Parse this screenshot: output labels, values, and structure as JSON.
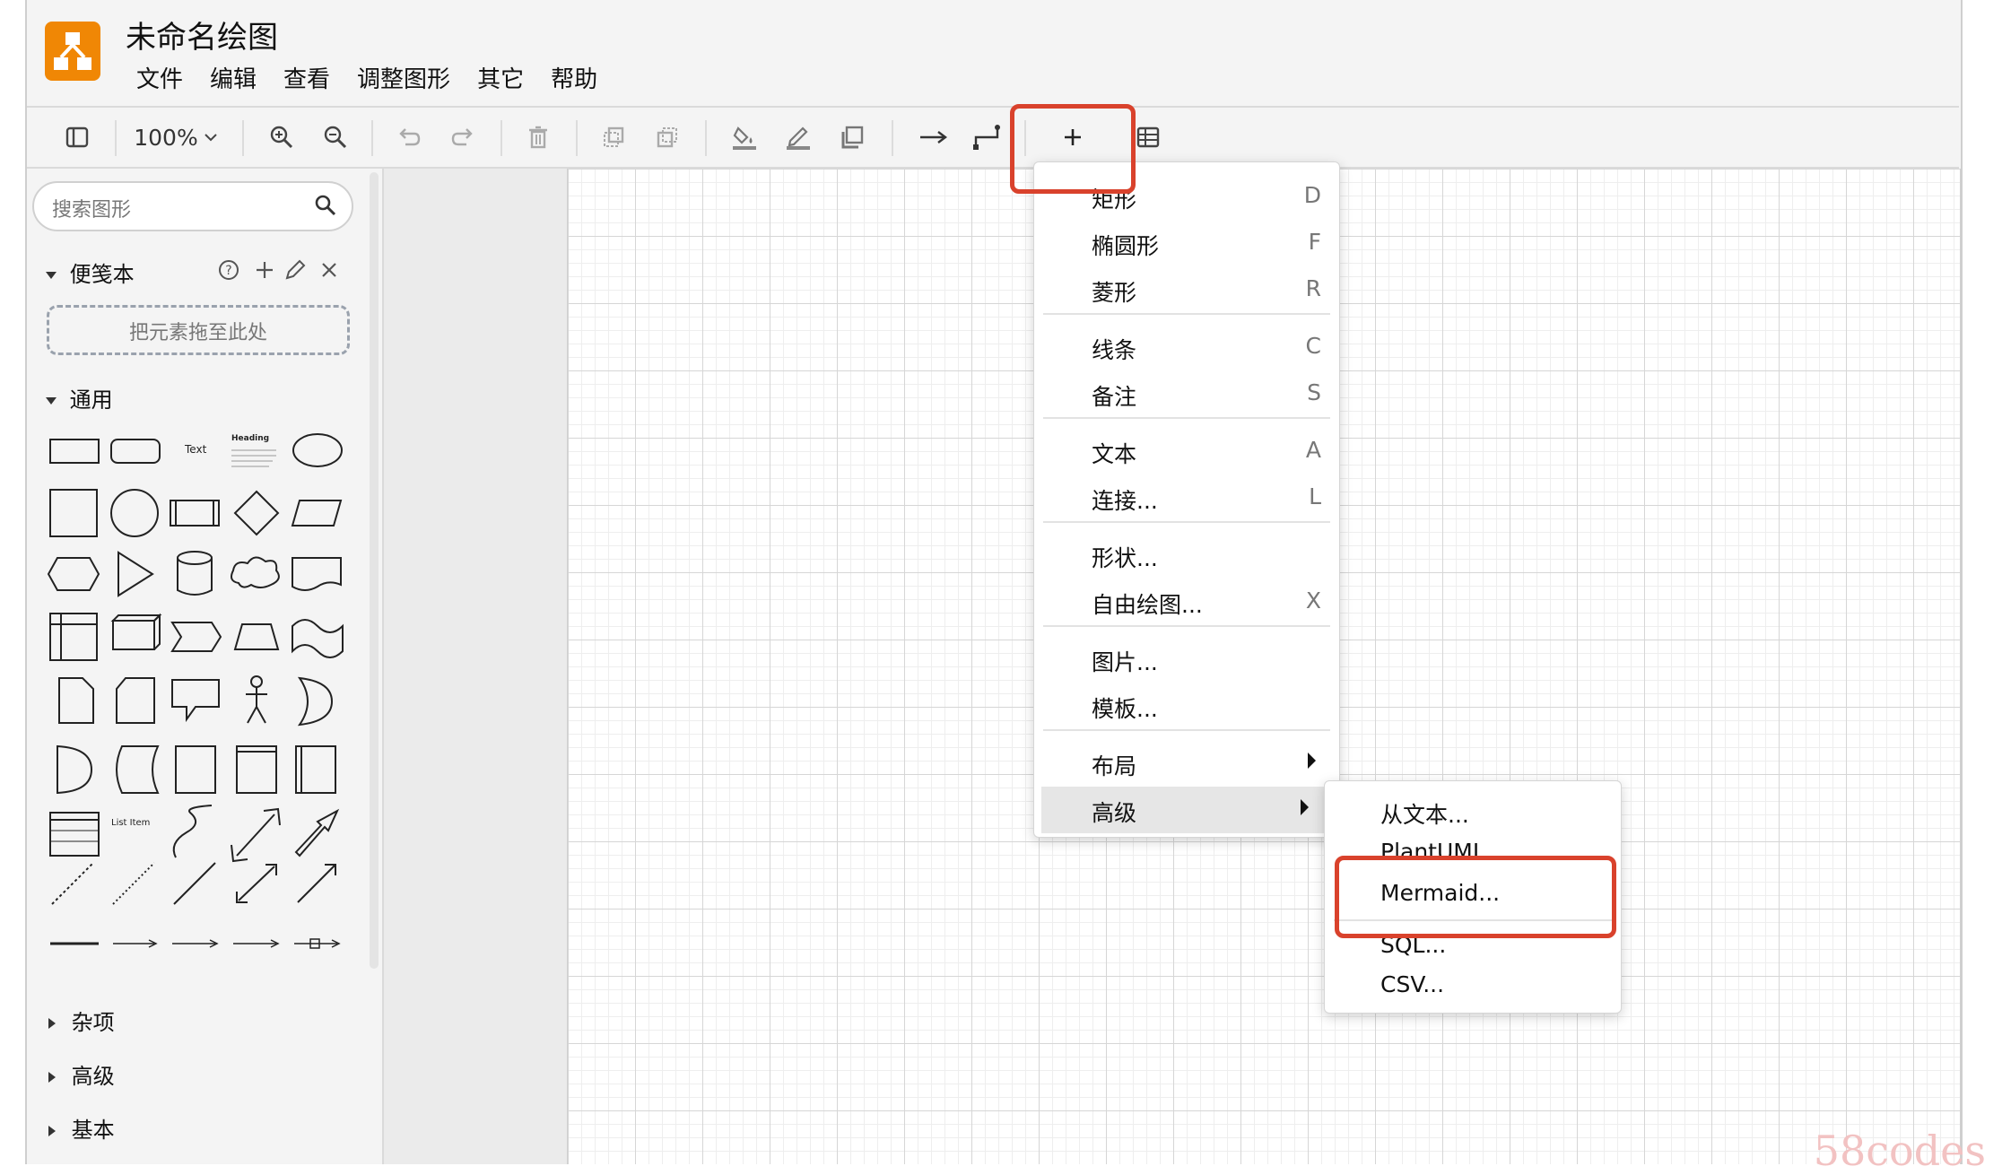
{
  "app": {
    "title": "未命名绘图",
    "menus": [
      "文件",
      "编辑",
      "查看",
      "调整图形",
      "其它",
      "帮助"
    ]
  },
  "toolbar": {
    "zoom_label": "100%"
  },
  "sidebar": {
    "search_placeholder": "搜索图形",
    "scratchpad_title": "便笺本",
    "dropzone_text": "把元素拖至此处",
    "general_title": "通用",
    "shape_text_label": "Text",
    "shape_heading_label": "Heading",
    "shape_list_item_label": "List Item",
    "collapsed_sections": [
      "杂项",
      "高级",
      "基本"
    ]
  },
  "insert_menu": {
    "items": [
      {
        "label": "矩形",
        "key": "D"
      },
      {
        "label": "椭圆形",
        "key": "F"
      },
      {
        "label": "菱形",
        "key": "R"
      },
      {
        "label": "线条",
        "key": "C"
      },
      {
        "label": "备注",
        "key": "S"
      },
      {
        "label": "文本",
        "key": "A"
      },
      {
        "label": "连接...",
        "key": "L"
      },
      {
        "label": "形状...",
        "key": ""
      },
      {
        "label": "自由绘图...",
        "key": "X"
      },
      {
        "label": "图片...",
        "key": ""
      },
      {
        "label": "模板...",
        "key": ""
      },
      {
        "label": "布局",
        "key": ""
      },
      {
        "label": "高级",
        "key": ""
      }
    ]
  },
  "advanced_submenu": {
    "items": [
      "从文本...",
      "PlantUML...",
      "Mermaid...",
      "SQL...",
      "CSV..."
    ]
  },
  "watermark": "58codes",
  "colors": {
    "logo": "#f08705",
    "highlight_box": "#d9422c"
  }
}
